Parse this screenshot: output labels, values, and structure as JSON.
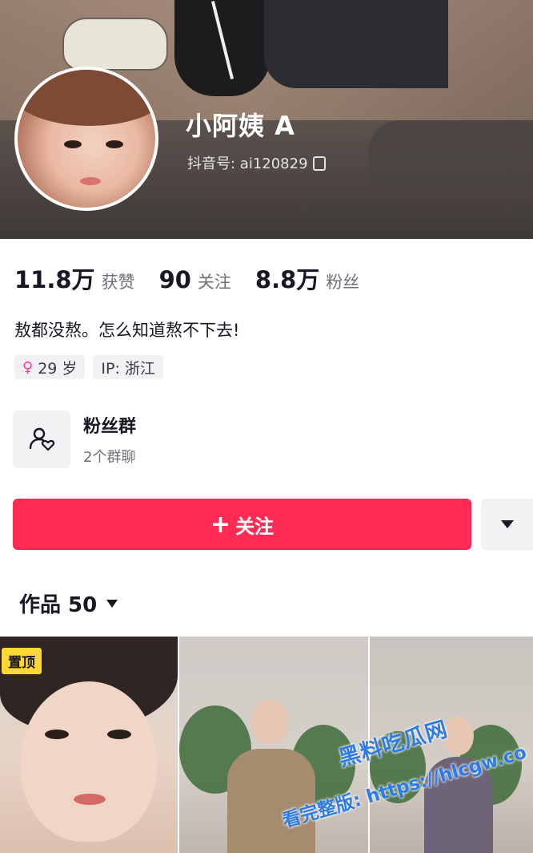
{
  "profile": {
    "name": "小阿姨 A",
    "douyin_id": "抖音号: ai120829"
  },
  "stats": [
    {
      "value": "11.8万",
      "label": "获赞"
    },
    {
      "value": "90",
      "label": "关注"
    },
    {
      "value": "8.8万",
      "label": "粉丝"
    }
  ],
  "bio": "敖都没熬。怎么知道熬不下去!",
  "tags": {
    "age": "29 岁",
    "ip": "IP: 浙江"
  },
  "fan_group": {
    "title": "粉丝群",
    "subtitle": "2个群聊"
  },
  "follow": {
    "plus": "+",
    "label": "关注"
  },
  "works": {
    "label": "作品 50"
  },
  "pinned_badge": "置顶",
  "watermark": {
    "line1": "黑料吃瓜网",
    "line2": "看完整版: https://hlcgw.co"
  },
  "colors": {
    "follow_button": "#fe2c55",
    "pin_badge": "#fdd835",
    "watermark": "#2f7be6"
  },
  "icons": [
    "copy-icon",
    "female-icon",
    "fan-group-icon",
    "dropdown-triangle-icon"
  ]
}
